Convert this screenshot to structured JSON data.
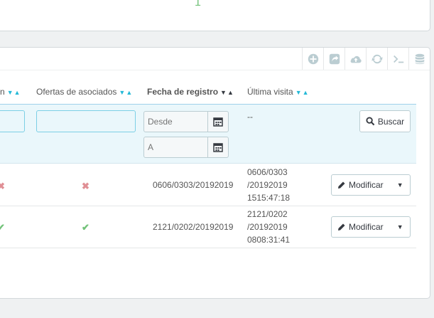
{
  "top": {
    "count": "1"
  },
  "toolbar": {
    "icons": [
      "plus-circle-icon",
      "export-icon",
      "cloud-upload-icon",
      "refresh-icon",
      "terminal-icon",
      "database-icon"
    ]
  },
  "headers": {
    "col_partial": "n",
    "col_offers": "Ofertas de asociados",
    "col_date": "Fecha de registro",
    "col_last": "Última visita",
    "sort_arrows": "▼▲"
  },
  "filters": {
    "from_placeholder": "Desde",
    "to_placeholder": "A",
    "last_visit_value": "--",
    "search_label": "Buscar"
  },
  "rows": [
    {
      "newsletter": "✖",
      "offers": "✖",
      "registered": "0606/0303/20192019",
      "last_visit_1": "0606/0303",
      "last_visit_2": "/20192019",
      "last_visit_3": "1515:47:18",
      "action": "Modificar"
    },
    {
      "newsletter": "✔",
      "offers": "✔",
      "registered": "2121/0202/20192019",
      "last_visit_1": "2121/0202",
      "last_visit_2": "/20192019",
      "last_visit_3": "0808:31:41",
      "action": "Modificar"
    }
  ],
  "colors": {
    "accent": "#25b9d7",
    "ok": "#72c279",
    "no": "#e08f95"
  }
}
